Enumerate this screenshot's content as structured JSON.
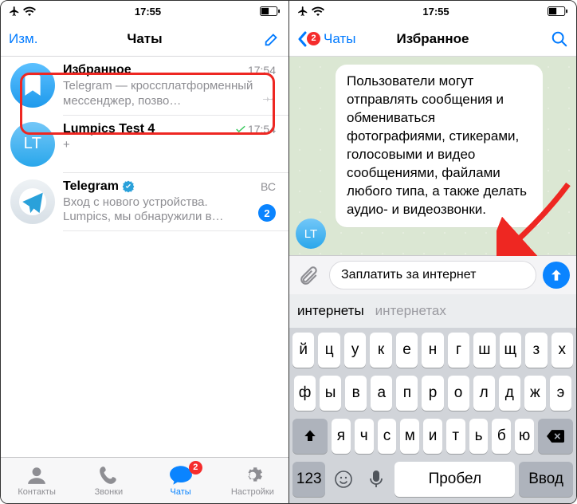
{
  "status": {
    "time": "17:55",
    "carrier_icons": [
      "airplane",
      "wifi"
    ],
    "battery_icon": "battery-medium"
  },
  "left": {
    "nav": {
      "edit": "Изм.",
      "title": "Чаты",
      "compose_icon": "compose-icon"
    },
    "chats": [
      {
        "avatar_text": "",
        "avatar_kind": "saved",
        "name": "Избранное",
        "time": "17:54",
        "message": "Telegram — кроссплатформенный мессенджер, позво…",
        "pinned": true,
        "unread": 0,
        "check": false,
        "verified": false
      },
      {
        "avatar_text": "LT",
        "avatar_kind": "lt",
        "name": "Lumpics Test 4",
        "time": "17:54",
        "message": "+",
        "pinned": false,
        "unread": 0,
        "check": true,
        "verified": false
      },
      {
        "avatar_text": "",
        "avatar_kind": "tg",
        "name": "Telegram",
        "time": "ВС",
        "message": "Вход с нового устройства. Lumpics, мы обнаружили в…",
        "pinned": false,
        "unread": 2,
        "check": false,
        "verified": true
      }
    ],
    "tabs": {
      "contacts": "Контакты",
      "calls": "Звонки",
      "chats": "Чаты",
      "settings": "Настройки",
      "chats_badge": "2"
    }
  },
  "right": {
    "nav": {
      "back": "Чаты",
      "back_badge": "2",
      "title": "Избранное",
      "search_icon": "search-icon"
    },
    "bubble_text": "Пользователи могут отправлять сообщения и обмениваться фотографиями, стикерами, голосовыми и видео сообщениями, файлами любого типа, а также делать аудио- и видеозвонки.",
    "bubble_avatar": "LT",
    "input_value": "Заплатить за интернет",
    "suggestions": {
      "main": "интернеты",
      "alt": "интернетах"
    },
    "kbd": {
      "row1": [
        "й",
        "ц",
        "у",
        "к",
        "е",
        "н",
        "г",
        "ш",
        "щ",
        "з",
        "х"
      ],
      "row2": [
        "ф",
        "ы",
        "в",
        "а",
        "п",
        "р",
        "о",
        "л",
        "д",
        "ж",
        "э"
      ],
      "row3_shift": "shift",
      "row3": [
        "я",
        "ч",
        "с",
        "м",
        "и",
        "т",
        "ь",
        "б",
        "ю"
      ],
      "row3_del": "backspace",
      "row4": {
        "num": "123",
        "space": "Пробел",
        "enter": "Ввод"
      }
    }
  },
  "colors": {
    "accent": "#0a84ff",
    "red": "#ee2722"
  }
}
